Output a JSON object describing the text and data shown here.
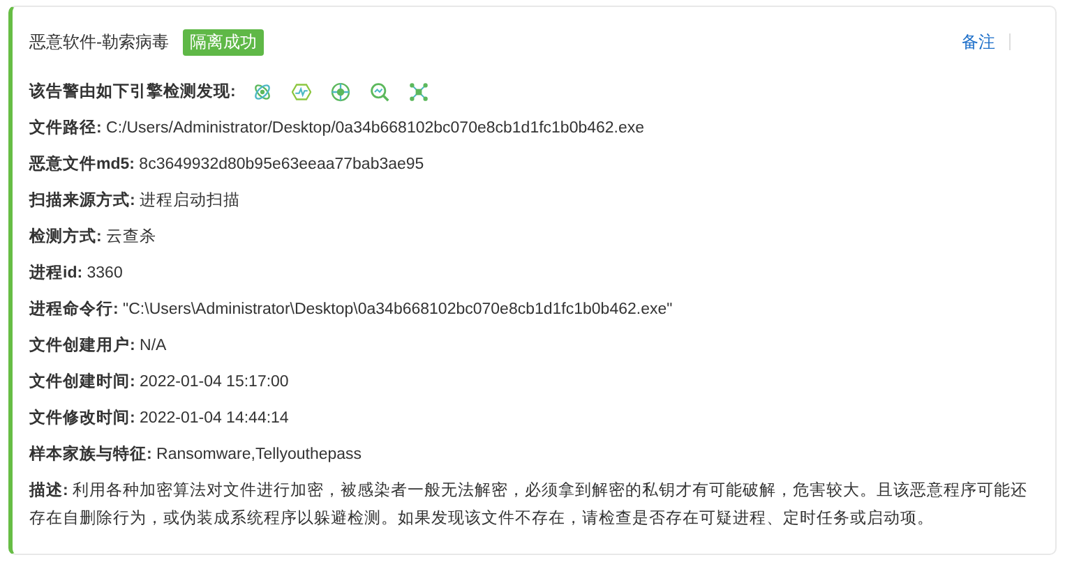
{
  "header": {
    "title": "恶意软件-勒索病毒",
    "badge": "隔离成功",
    "note_link": "备注"
  },
  "engines": {
    "label": "该告警由如下引擎检测发现:",
    "icons": [
      {
        "kind": "atom"
      },
      {
        "kind": "wave"
      },
      {
        "kind": "target"
      },
      {
        "kind": "search"
      },
      {
        "kind": "network"
      }
    ]
  },
  "fields": [
    {
      "label": "文件路径:",
      "value": "C:/Users/Administrator/Desktop/0a34b668102bc070e8cb1d1fc1b0b462.exe"
    },
    {
      "label": "恶意文件md5:",
      "value": "8c3649932d80b95e63eeaa77bab3ae95"
    },
    {
      "label": "扫描来源方式:",
      "value": "进程启动扫描"
    },
    {
      "label": "检测方式:",
      "value": "云查杀"
    },
    {
      "label": "进程id:",
      "value": "3360"
    },
    {
      "label": "进程命令行:",
      "value": "\"C:\\Users\\Administrator\\Desktop\\0a34b668102bc070e8cb1d1fc1b0b462.exe\""
    },
    {
      "label": "文件创建用户:",
      "value": "N/A"
    },
    {
      "label": "文件创建时间:",
      "value": "2022-01-04 15:17:00"
    },
    {
      "label": "文件修改时间:",
      "value": "2022-01-04 14:44:14"
    },
    {
      "label": "样本家族与特征:",
      "value": "Ransomware,Tellyouthepass"
    },
    {
      "label": "描述:",
      "value": "利用各种加密算法对文件进行加密，被感染者一般无法解密，必须拿到解密的私钥才有可能破解，危害较大。且该恶意程序可能还存在自删除行为，或伪装成系统程序以躲避检测。如果发现该文件不存在，请检查是否存在可疑进程、定时任务或启动项。"
    }
  ]
}
